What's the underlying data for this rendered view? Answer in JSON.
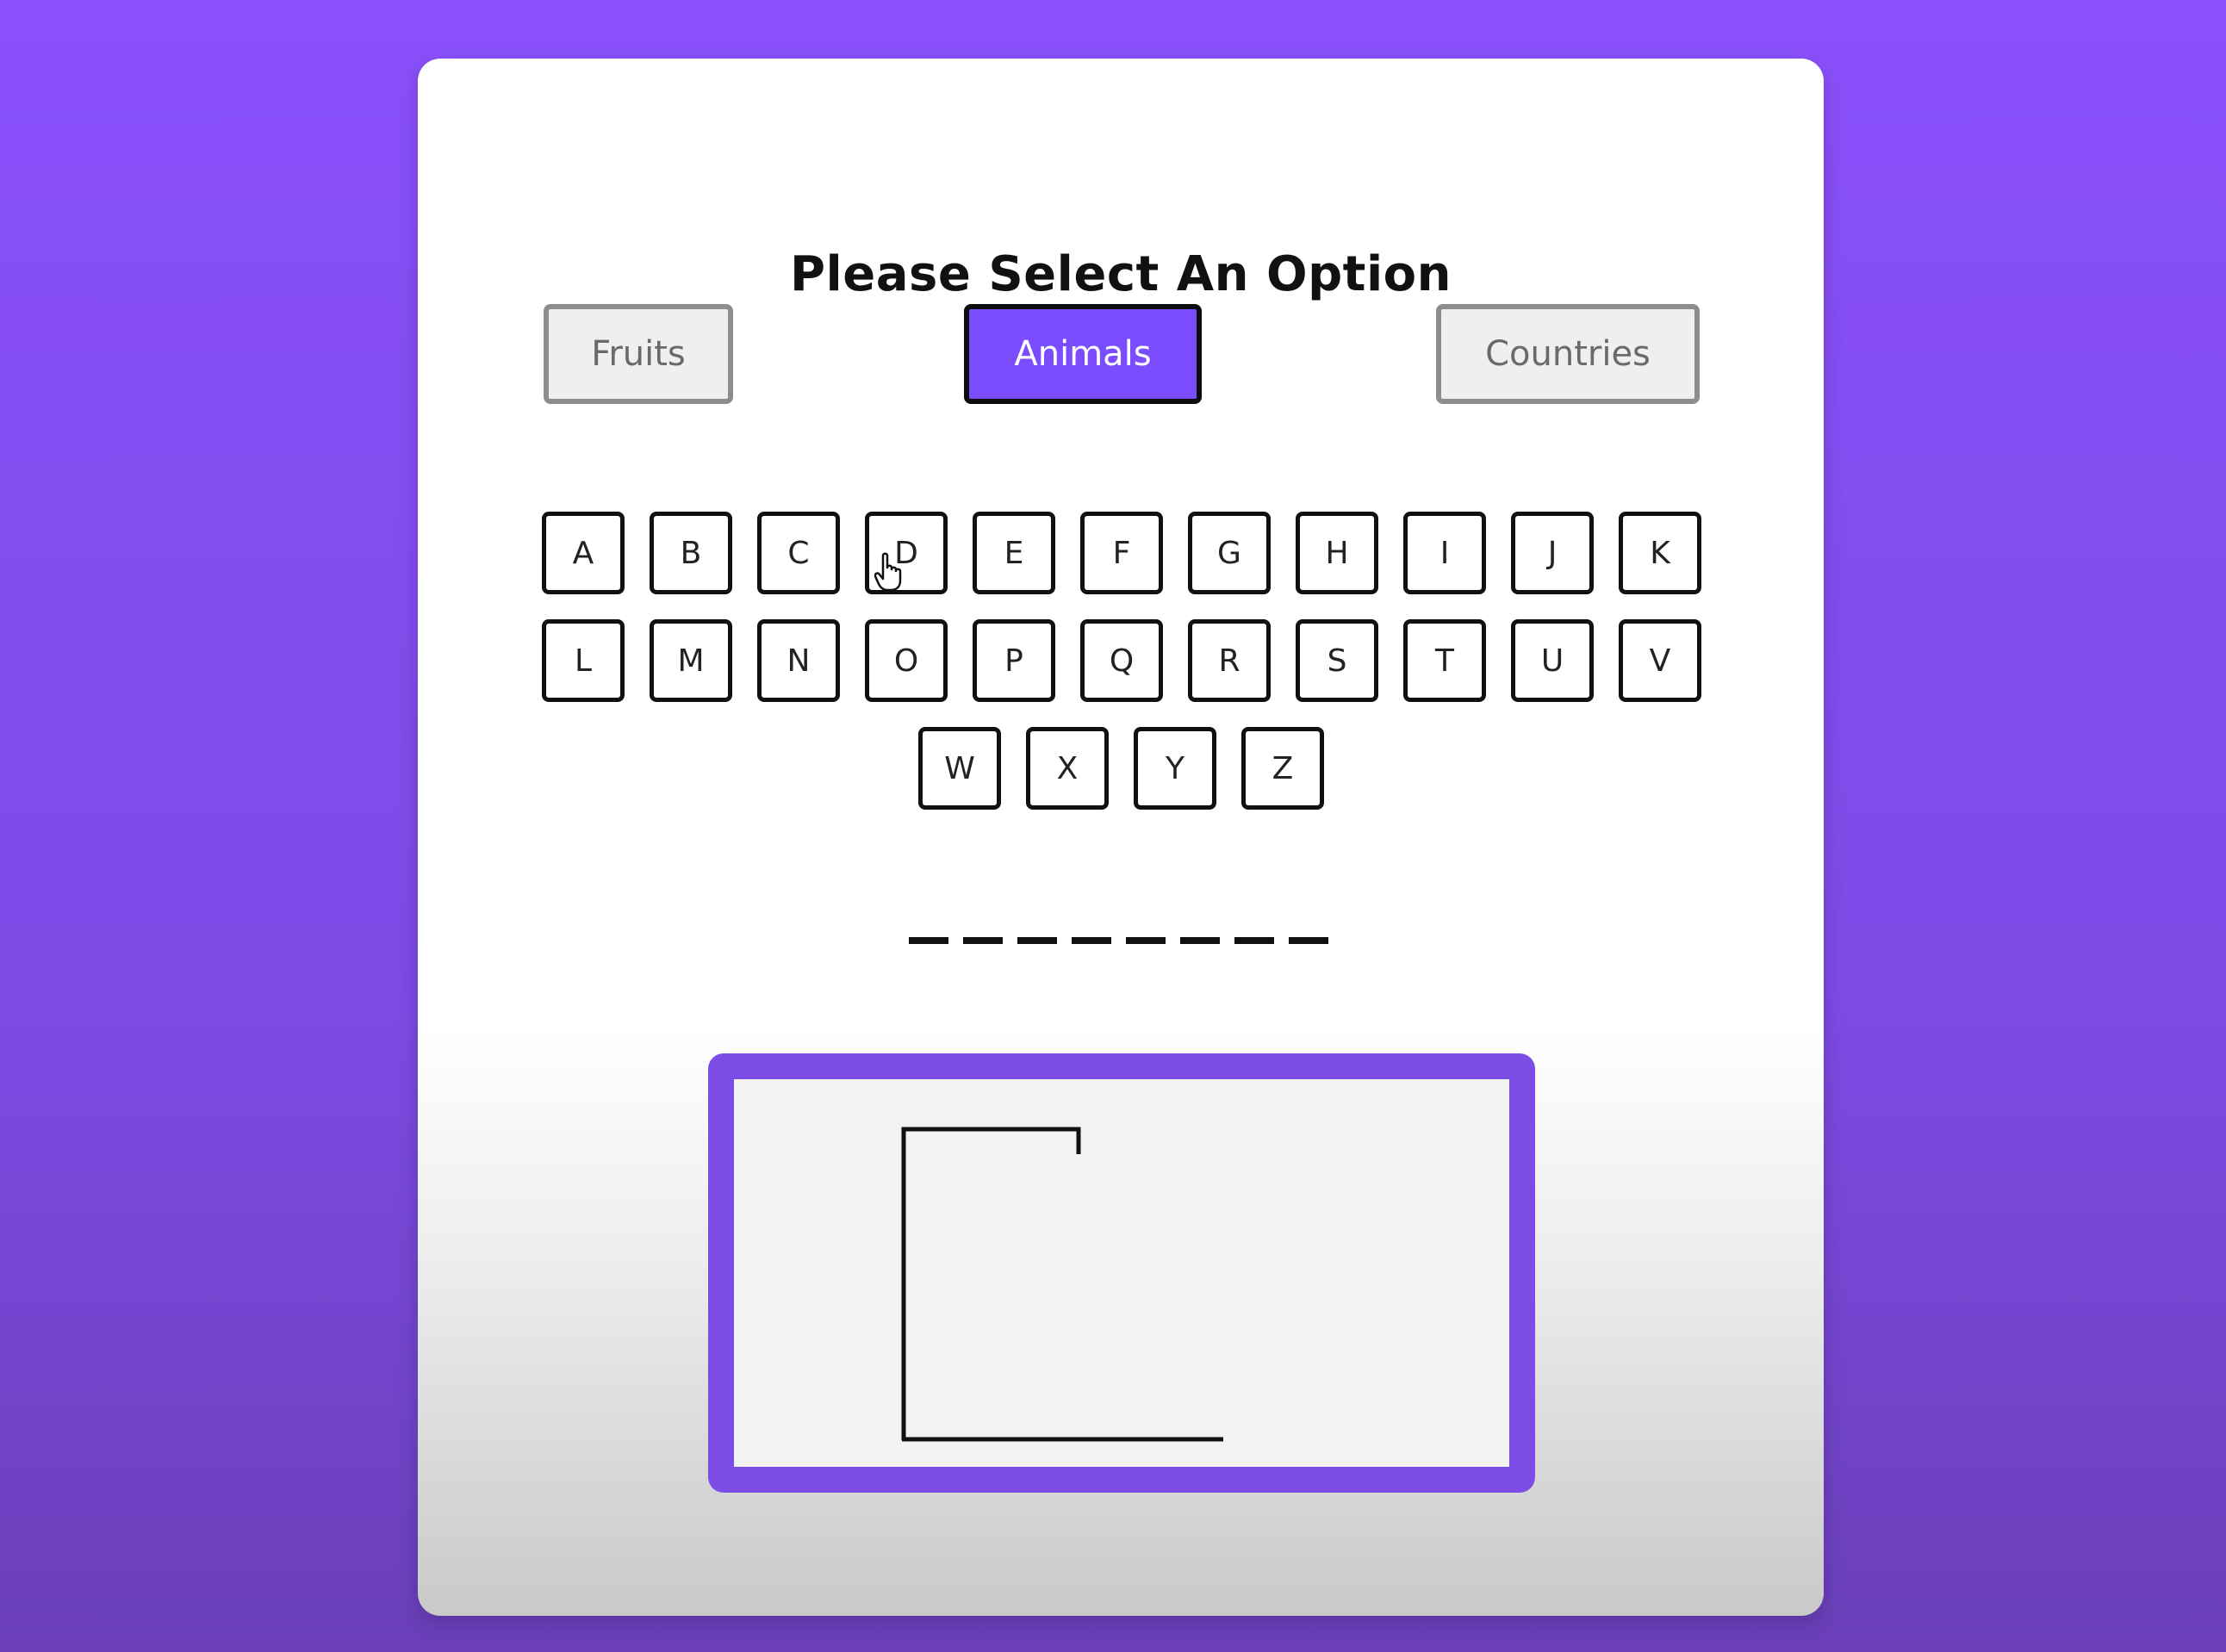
{
  "title": "Please Select An Option",
  "categories": [
    {
      "label": "Fruits",
      "active": false
    },
    {
      "label": "Animals",
      "active": true
    },
    {
      "label": "Countries",
      "active": false
    }
  ],
  "keys": [
    "A",
    "B",
    "C",
    "D",
    "E",
    "F",
    "G",
    "H",
    "I",
    "J",
    "K",
    "L",
    "M",
    "N",
    "O",
    "P",
    "Q",
    "R",
    "S",
    "T",
    "U",
    "V",
    "W",
    "X",
    "Y",
    "Z"
  ],
  "colors": {
    "background": "#8a50fb",
    "accent": "#7c4dff",
    "frame": "#7c4ce6"
  },
  "hidden_word_length": 8,
  "cursor_icon": "hand-pointer-icon"
}
